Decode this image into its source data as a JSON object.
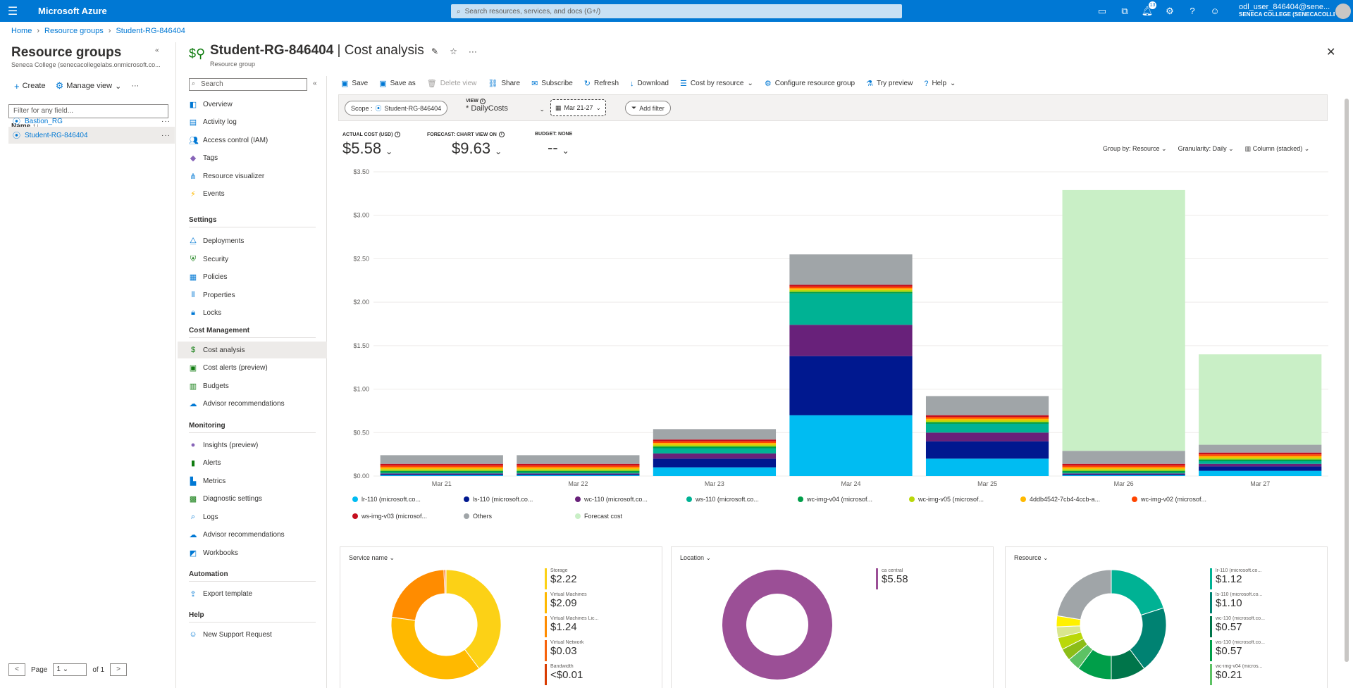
{
  "topbar": {
    "brand": "Microsoft Azure",
    "search_placeholder": "Search resources, services, and docs (G+/)",
    "notif_count": "13",
    "username": "odl_user_846404@sene...",
    "tenant": "SENECA COLLEGE (SENECACOLLE..."
  },
  "breadcrumb": [
    "Home",
    "Resource groups",
    "Student-RG-846404"
  ],
  "left": {
    "title": "Resource groups",
    "subtitle": "Seneca College (senecacollegelabs.onmicrosoft.co...",
    "create": "Create",
    "manage_view": "Manage view",
    "filter_placeholder": "Filter for any field...",
    "col_name": "Name",
    "rows": [
      "Bastion_RG",
      "Student-RG-846404"
    ],
    "page_label": "Page",
    "page_value": "1",
    "page_of": "of 1"
  },
  "resource": {
    "name": "Student-RG-846404",
    "title_suffix": " | Cost analysis",
    "subtitle": "Resource group"
  },
  "menu": {
    "search": "Search",
    "items_top": [
      "Overview",
      "Activity log",
      "Access control (IAM)",
      "Tags",
      "Resource visualizer",
      "Events"
    ],
    "settings_head": "Settings",
    "settings": [
      "Deployments",
      "Security",
      "Policies",
      "Properties",
      "Locks"
    ],
    "cost_head": "Cost Management",
    "cost": [
      "Cost analysis",
      "Cost alerts (preview)",
      "Budgets",
      "Advisor recommendations"
    ],
    "monitoring_head": "Monitoring",
    "monitoring": [
      "Insights (preview)",
      "Alerts",
      "Metrics",
      "Diagnostic settings",
      "Logs",
      "Advisor recommendations",
      "Workbooks"
    ],
    "automation_head": "Automation",
    "automation": [
      "Export template"
    ],
    "help_head": "Help",
    "help": [
      "New Support Request"
    ]
  },
  "commands": [
    "Save",
    "Save as",
    "Delete view",
    "Share",
    "Subscribe",
    "Refresh",
    "Download",
    "Cost by resource",
    "Configure resource group",
    "Try preview",
    "Help"
  ],
  "filters": {
    "scope": "Scope : ",
    "scope_value": "Student-RG-846404",
    "view_label": "VIEW",
    "view_value": "* DailyCosts",
    "date": "Mar 21-27",
    "add_filter": "Add filter"
  },
  "kpis": [
    {
      "label": "ACTUAL COST (USD)",
      "value": "$5.58"
    },
    {
      "label": "FORECAST: CHART VIEW ON",
      "value": "$9.63"
    },
    {
      "label": "BUDGET: NONE",
      "value": "--"
    }
  ],
  "chart_options": [
    "Group by: Resource",
    "Granularity: Daily",
    "Column (stacked)"
  ],
  "chart_data": {
    "type": "bar",
    "categories": [
      "Mar 21",
      "Mar 22",
      "Mar 23",
      "Mar 24",
      "Mar 25",
      "Mar 26",
      "Mar 27"
    ],
    "ylim": [
      0,
      3.5
    ],
    "yticks": [
      "$0.00",
      "$0.50",
      "$1.00",
      "$1.50",
      "$2.00",
      "$2.50",
      "$3.00",
      "$3.50"
    ],
    "series": [
      {
        "name": "lr-110 (microsoft.co...",
        "color": "#00bcf2",
        "values": [
          0.01,
          0.01,
          0.1,
          0.7,
          0.2,
          0.01,
          0.06
        ]
      },
      {
        "name": "ls-110 (microsoft.co...",
        "color": "#00188f",
        "values": [
          0.01,
          0.01,
          0.1,
          0.68,
          0.2,
          0.01,
          0.05
        ]
      },
      {
        "name": "wc-110 (microsoft.co...",
        "color": "#68217a",
        "values": [
          0.01,
          0.01,
          0.06,
          0.36,
          0.1,
          0.01,
          0.03
        ]
      },
      {
        "name": "ws-110 (microsoft.co...",
        "color": "#00b294",
        "values": [
          0.01,
          0.01,
          0.06,
          0.36,
          0.1,
          0.01,
          0.03
        ]
      },
      {
        "name": "wc-img-v04 (microsof...",
        "color": "#009e49",
        "values": [
          0.02,
          0.02,
          0.02,
          0.02,
          0.02,
          0.02,
          0.02
        ]
      },
      {
        "name": "wc-img-v05 (microsof...",
        "color": "#bad80a",
        "values": [
          0.02,
          0.02,
          0.02,
          0.02,
          0.02,
          0.02,
          0.02
        ]
      },
      {
        "name": "4ddb4542-7cb4-4ccb-a...",
        "color": "#ffb900",
        "values": [
          0.02,
          0.02,
          0.02,
          0.02,
          0.02,
          0.02,
          0.02
        ]
      },
      {
        "name": "wc-img-v02 (microsof...",
        "color": "#ff4500",
        "values": [
          0.02,
          0.02,
          0.02,
          0.02,
          0.02,
          0.02,
          0.02
        ]
      },
      {
        "name": "ws-img-v03 (microsof...",
        "color": "#c50f1f",
        "values": [
          0.02,
          0.02,
          0.02,
          0.02,
          0.02,
          0.02,
          0.02
        ]
      },
      {
        "name": "Others",
        "color": "#a0a5a8",
        "values": [
          0.1,
          0.1,
          0.12,
          0.35,
          0.22,
          0.15,
          0.09
        ]
      },
      {
        "name": "Forecast cost",
        "color": "#c9efc6",
        "values": [
          0,
          0,
          0,
          0,
          0,
          3.0,
          1.04
        ]
      }
    ]
  },
  "cards": [
    {
      "title": "Service name",
      "slices": [
        {
          "name": "Storage",
          "value": "$2.22",
          "amount": 2.22,
          "color": "#fcd116"
        },
        {
          "name": "Virtual Machines",
          "value": "$2.09",
          "amount": 2.09,
          "color": "#ffb900"
        },
        {
          "name": "Virtual Machines Lic...",
          "value": "$1.24",
          "amount": 1.24,
          "color": "#ff8c00"
        },
        {
          "name": "Virtual Network",
          "value": "$0.03",
          "amount": 0.03,
          "color": "#f7630c"
        },
        {
          "name": "Bandwidth",
          "value": "<$0.01",
          "amount": 0.005,
          "color": "#d83b01"
        }
      ]
    },
    {
      "title": "Location",
      "slices": [
        {
          "name": "ca central",
          "value": "$5.58",
          "amount": 5.58,
          "color": "#9b4f96"
        }
      ]
    },
    {
      "title": "Resource",
      "slices": [
        {
          "name": "lr-110 (microsoft.co...",
          "value": "$1.12",
          "amount": 1.12,
          "color": "#00b294"
        },
        {
          "name": "ls-110 (microsoft.co...",
          "value": "$1.10",
          "amount": 1.1,
          "color": "#008272"
        },
        {
          "name": "wc-110 (microsoft.co...",
          "value": "$0.57",
          "amount": 0.57,
          "color": "#00754a"
        },
        {
          "name": "ws-110 (microsoft.co...",
          "value": "$0.57",
          "amount": 0.57,
          "color": "#009e49"
        },
        {
          "name": "wc-img-v04 (micros...",
          "value": "$0.21",
          "amount": 0.21,
          "color": "#5dc264"
        },
        {
          "name": "",
          "value": "",
          "amount": 0.2,
          "color": "#8cbd18"
        },
        {
          "name": "",
          "value": "",
          "amount": 0.2,
          "color": "#bad80a"
        },
        {
          "name": "",
          "value": "",
          "amount": 0.18,
          "color": "#d9e68e"
        },
        {
          "name": "",
          "value": "",
          "amount": 0.18,
          "color": "#fff100"
        },
        {
          "name": "",
          "value": "",
          "amount": 1.25,
          "color": "#a0a5a8"
        }
      ]
    }
  ]
}
